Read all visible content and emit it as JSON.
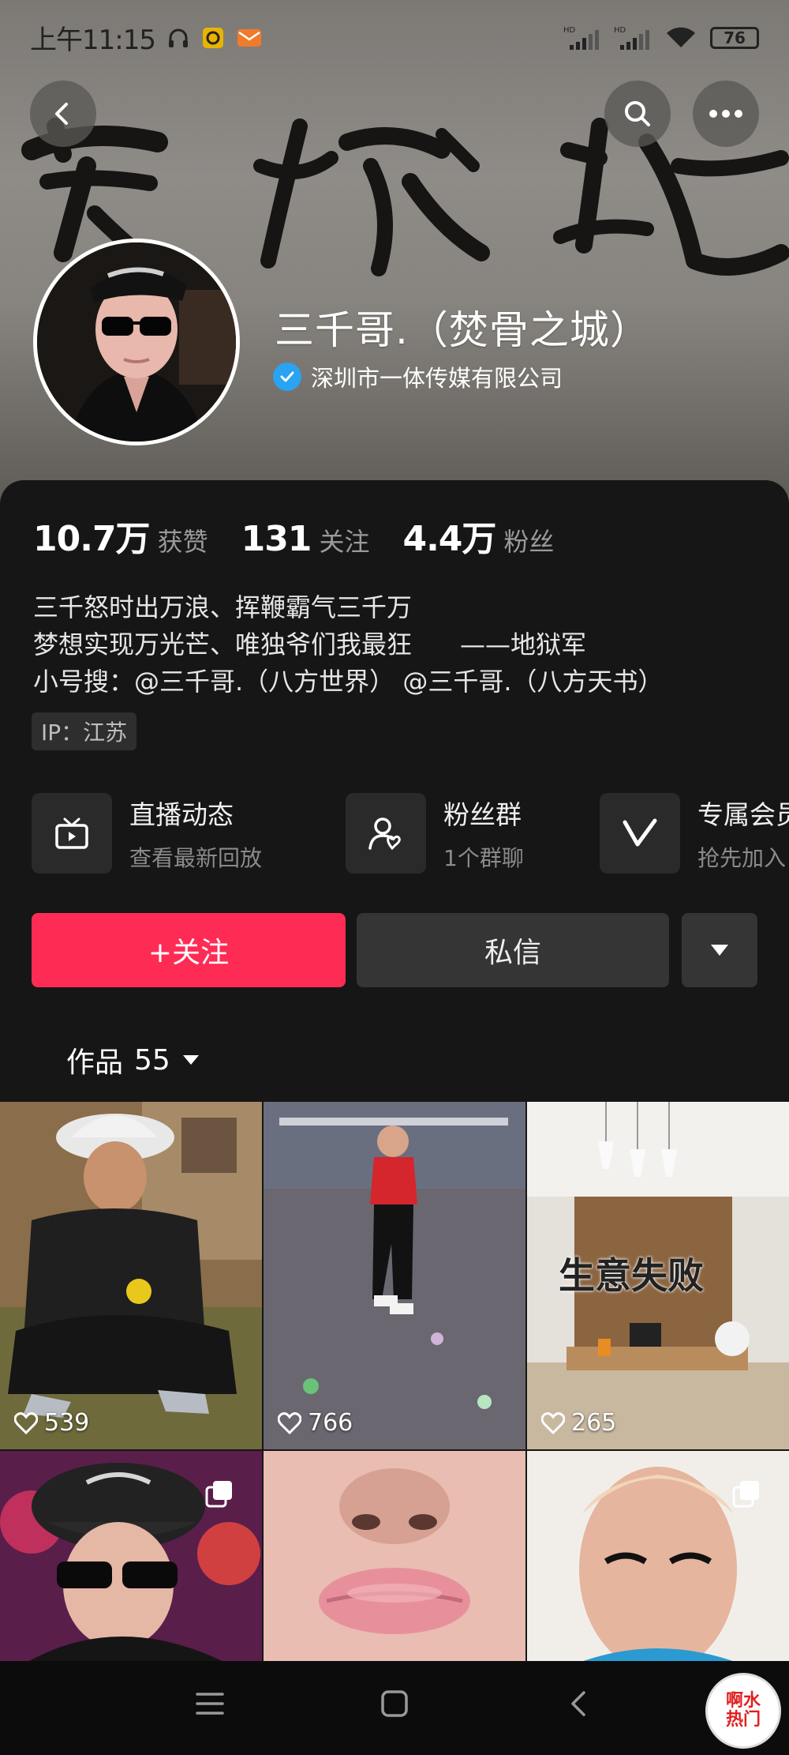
{
  "status_bar": {
    "time": "上午11:15",
    "battery": "76"
  },
  "banner": {
    "calligraphy": "牢狱地"
  },
  "profile": {
    "name": "三千哥.（焚骨之城）",
    "verification": "深圳市一体传媒有限公司"
  },
  "stats": [
    {
      "value": "10.7万",
      "label": "获赞"
    },
    {
      "value": "131",
      "label": "关注"
    },
    {
      "value": "4.4万",
      "label": "粉丝"
    }
  ],
  "bio": {
    "line1": "三千怒时出万浪、挥鞭霸气三千万",
    "line2": "梦想实现万光芒、唯独爷们我最狂      ——地狱军",
    "line3": "小号搜：@三千哥.（八方世界） @三千哥.（八方天书）"
  },
  "ip_tag": "IP：江苏",
  "features": [
    {
      "title": "直播动态",
      "subtitle": "查看最新回放"
    },
    {
      "title": "粉丝群",
      "subtitle": "1个群聊"
    },
    {
      "title": "专属会员",
      "subtitle": "抢先加入"
    }
  ],
  "actions": {
    "follow": "+关注",
    "message": "私信"
  },
  "tabs": {
    "works_label": "作品",
    "works_count": "55"
  },
  "videos": [
    {
      "likes": "539"
    },
    {
      "likes": "766"
    },
    {
      "likes": "265",
      "overlay": "生意失败"
    },
    {},
    {},
    {}
  ],
  "watermark": {
    "line1": "啊水",
    "line2": "热门"
  },
  "colors": {
    "accent": "#fe2c55",
    "panel_bg": "#161616",
    "verify": "#2aa3f2"
  }
}
